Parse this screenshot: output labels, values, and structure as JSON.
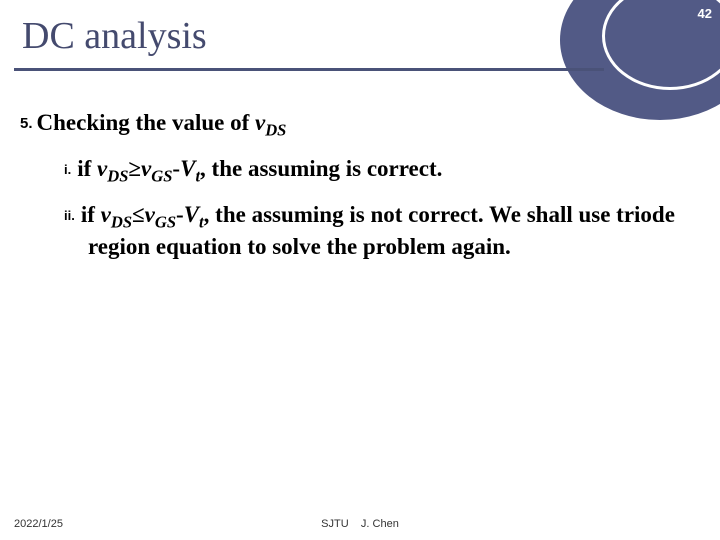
{
  "page_number": "42",
  "title": "DC analysis",
  "main": {
    "num": "5.",
    "heading_pre": "Checking the value of ",
    "heading_var": "v",
    "heading_sub": "DS"
  },
  "items": [
    {
      "roman": "i.",
      "pre": "if ",
      "v1": "v",
      "s1": "DS",
      "op": "≥",
      "v2": "v",
      "s2": "GS",
      "minus": "-",
      "v3": "V",
      "s3": "t",
      "post": ", the assuming is correct."
    },
    {
      "roman": "ii.",
      "pre": "if ",
      "v1": "v",
      "s1": "DS",
      "op": "≤",
      "v2": "v",
      "s2": "GS",
      "minus": "-",
      "v3": "V",
      "s3": "t",
      "post": ", the assuming is not correct. We shall use triode region equation to solve the problem again."
    }
  ],
  "footer": {
    "date": "2022/1/25",
    "org": "SJTU",
    "author": "J. Chen"
  }
}
